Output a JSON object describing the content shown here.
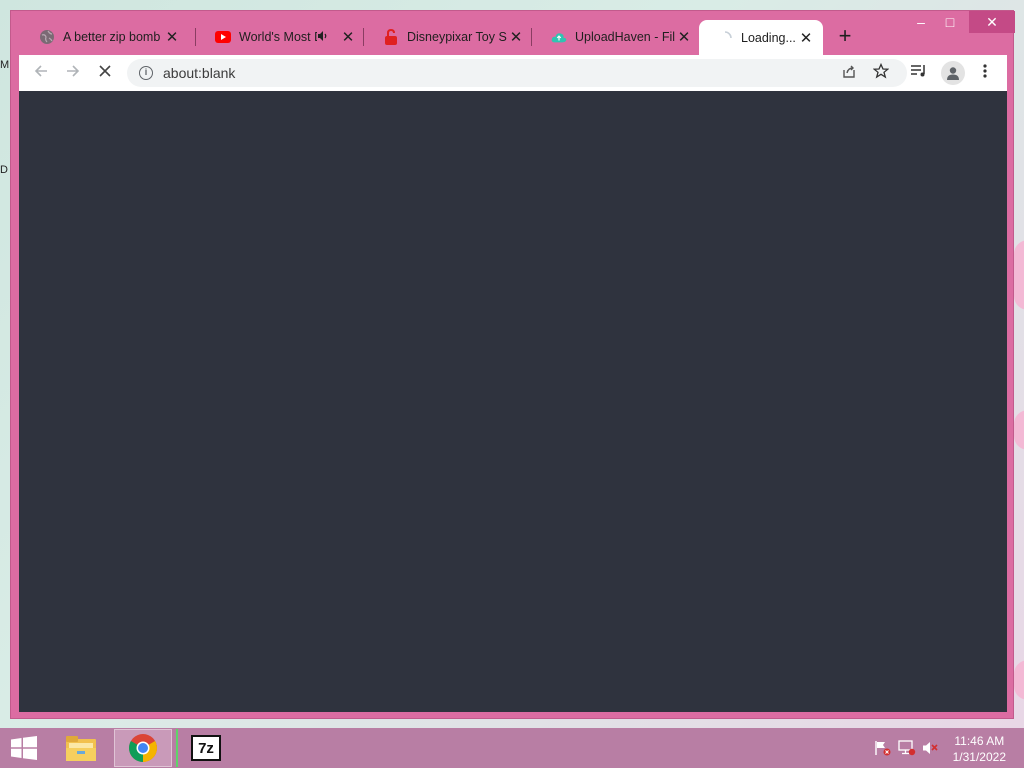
{
  "browser": {
    "tabs": [
      {
        "title": "A better zip bomb",
        "favicon": "globe-icon"
      },
      {
        "title": "World's Most D",
        "favicon": "youtube-icon",
        "audio": "speaker-icon"
      },
      {
        "title": "Disneypixar Toy Sto",
        "favicon": "lock-red-icon"
      },
      {
        "title": "UploadHaven - File",
        "favicon": "cloud-icon"
      },
      {
        "title": "Loading...",
        "favicon": "spinner-icon",
        "active": true
      }
    ],
    "new_tab": "+",
    "address": "about:blank",
    "window_controls": {
      "minimize": "–",
      "maximize": "□",
      "close": "✕"
    },
    "colors": {
      "frame": "#dc6ca2",
      "content": "#2f333e"
    }
  },
  "taskbar": {
    "apps": [
      "file-explorer-icon",
      "chrome-icon",
      "7zip-icon"
    ],
    "sevenzip_label": "7z",
    "clock": {
      "time": "11:46 AM",
      "date": "1/31/2022"
    }
  },
  "desktop": {
    "glyph_1": "M",
    "glyph_2": "D"
  }
}
